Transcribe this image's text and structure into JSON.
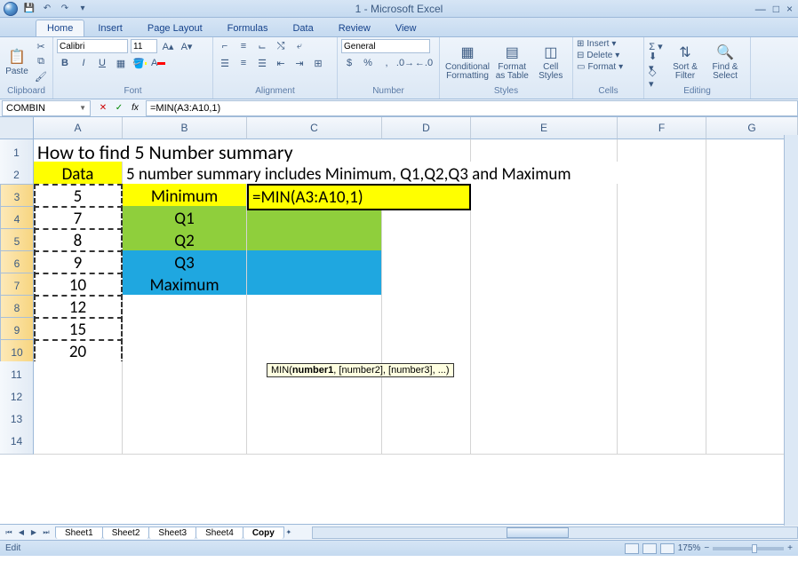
{
  "title": "1 - Microsoft Excel",
  "tabs": [
    "Home",
    "Insert",
    "Page Layout",
    "Formulas",
    "Data",
    "Review",
    "View"
  ],
  "active_tab": 0,
  "ribbon": {
    "clipboard": {
      "label": "Clipboard",
      "paste": "Paste"
    },
    "font": {
      "label": "Font",
      "name": "Calibri",
      "size": "11"
    },
    "alignment": {
      "label": "Alignment"
    },
    "number": {
      "label": "Number",
      "format": "General"
    },
    "styles": {
      "label": "Styles",
      "cond": "Conditional Formatting",
      "fmt": "Format as Table",
      "cell": "Cell Styles"
    },
    "cells": {
      "label": "Cells",
      "insert": "Insert",
      "delete": "Delete",
      "format": "Format"
    },
    "editing": {
      "label": "Editing",
      "sort": "Sort & Filter",
      "find": "Find & Select"
    }
  },
  "namebox": "COMBIN",
  "formula": "=MIN(A3:A10,1)",
  "tooltip_prefix": "MIN(",
  "tooltip_bold": "number1",
  "tooltip_suffix": ", [number2], [number3], ...)",
  "columns": [
    "A",
    "B",
    "C",
    "D",
    "E",
    "F",
    "G"
  ],
  "rows": {
    "1": {
      "A": "How to find 5 Number summary"
    },
    "2": {
      "A": "Data",
      "B": "5 number summary includes Minimum, Q1,Q2,Q3 and Maximum"
    },
    "3": {
      "A": "5",
      "B": "Minimum",
      "C": "=MIN(A3:A10,1)"
    },
    "4": {
      "A": "7",
      "B": "Q1"
    },
    "5": {
      "A": "8",
      "B": "Q2"
    },
    "6": {
      "A": "9",
      "B": "Q3"
    },
    "7": {
      "A": "10",
      "B": "Maximum"
    },
    "8": {
      "A": "12"
    },
    "9": {
      "A": "15"
    },
    "10": {
      "A": "20"
    }
  },
  "sheet_tabs": [
    "Sheet1",
    "Sheet2",
    "Sheet3",
    "Sheet4",
    "Copy"
  ],
  "status": "Edit",
  "zoom": "175%"
}
